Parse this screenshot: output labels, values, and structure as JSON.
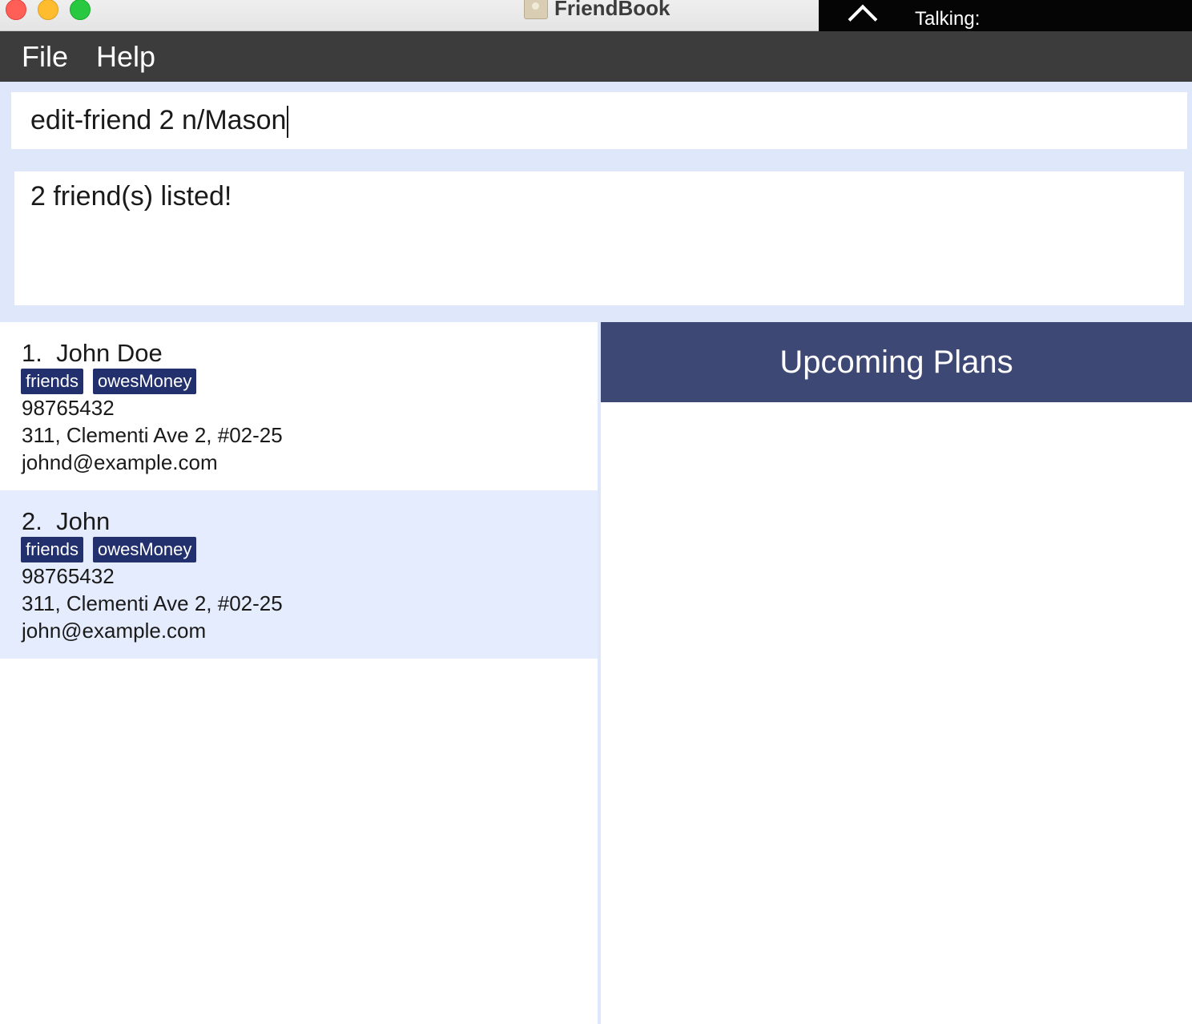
{
  "window": {
    "title": "FriendBook",
    "overlay_label": "Talking:"
  },
  "menu": {
    "file": "File",
    "help": "Help"
  },
  "command": {
    "value": "edit-friend 2 n/Mason"
  },
  "result": {
    "message": "2 friend(s) listed!"
  },
  "friends": [
    {
      "index_name": "1.  John Doe",
      "tags": [
        "friends",
        "owesMoney"
      ],
      "phone": "98765432",
      "address": "311, Clementi Ave 2, #02-25",
      "email": "johnd@example.com"
    },
    {
      "index_name": "2.  John",
      "tags": [
        "friends",
        "owesMoney"
      ],
      "phone": "98765432",
      "address": "311, Clementi Ave 2, #02-25",
      "email": "john@example.com"
    }
  ],
  "plans": {
    "title": "Upcoming Plans"
  },
  "colors": {
    "menubar": "#3c3c3c",
    "panel_bg": "#dfe8fb",
    "tag_bg": "#22306e",
    "plans_header": "#3e4874",
    "selected_card": "#e5ecfd"
  }
}
